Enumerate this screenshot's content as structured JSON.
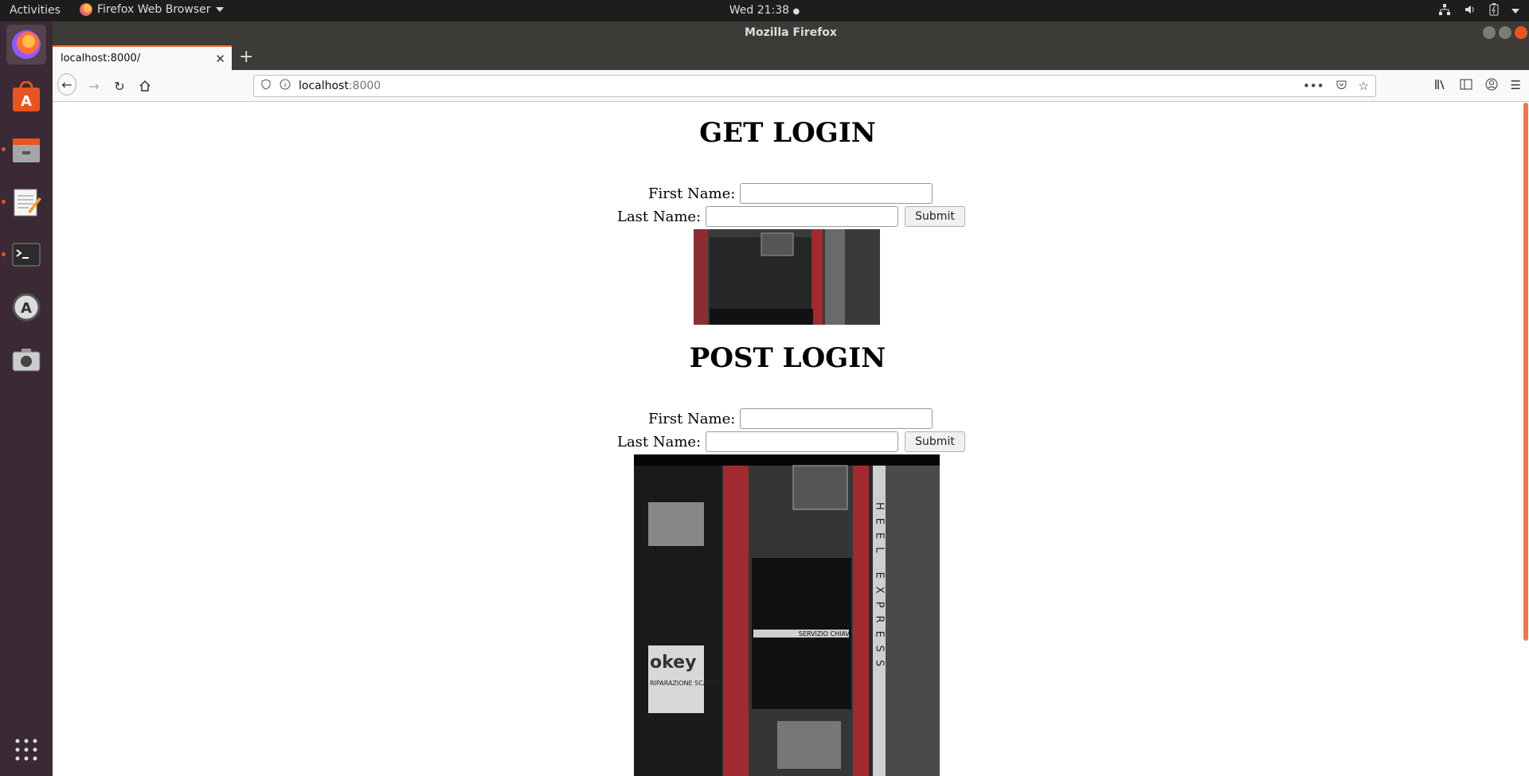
{
  "topbar": {
    "activities": "Activities",
    "app_name": "Firefox Web Browser",
    "clock": "Wed 21:38"
  },
  "window": {
    "title": "Mozilla Firefox"
  },
  "tab": {
    "label": "localhost:8000/"
  },
  "urlbar": {
    "host": "localhost",
    "port": ":8000"
  },
  "page": {
    "get_section": {
      "heading": "GET LOGIN",
      "first_name_label": "First Name:",
      "last_name_label": "Last Name:",
      "first_name_value": "",
      "last_name_value": "",
      "submit_label": "Submit"
    },
    "post_section": {
      "heading": "POST LOGIN",
      "first_name_label": "First Name:",
      "last_name_label": "Last Name:",
      "first_name_value": "",
      "last_name_value": "",
      "submit_label": "Submit"
    },
    "photo_texts": {
      "vertical_sign": "HEEL EXPRESS",
      "shop_sign": "SERVIZIO CHIAVI",
      "poster_brand": "okey",
      "poster_sub": "RIPARAZIONE SCARPE"
    }
  },
  "colors": {
    "accent": "#ff7139",
    "dock_bg": "#3b2a35",
    "topbar_bg": "#1d1d1d",
    "door_red": "#a12a30"
  },
  "icons": {
    "dock": [
      "firefox-icon",
      "software-store-icon",
      "files-icon",
      "text-editor-icon",
      "terminal-icon",
      "software-updater-icon",
      "screenshot-icon",
      "app-grid-icon"
    ]
  }
}
